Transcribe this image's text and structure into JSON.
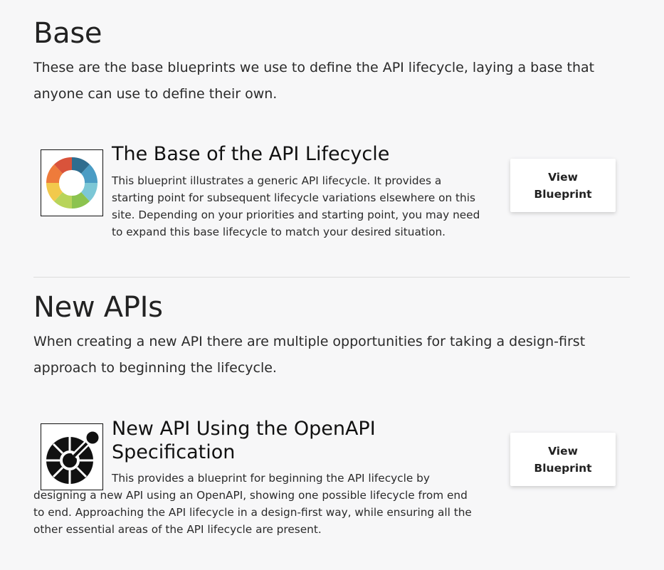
{
  "sections": [
    {
      "title": "Base",
      "description": "These are the base blueprints we use to define the API lifecycle, laying a base that anyone can use to define their own.",
      "card": {
        "title": "The Base of the API Lifecycle",
        "description": "This blueprint illustrates a generic API lifecycle. It provides a starting point for subsequent lifecycle variations elsewhere on this site. Depending on your priorities and starting point, you may need to expand this base lifecycle to match your desired situation.",
        "button_label": "View Blueprint",
        "image_icon": "lifecycle-cycle-diagram-icon"
      }
    },
    {
      "title": "New APIs",
      "description": "When creating a new API there are multiple opportunities for taking a design-first approach to beginning the lifecycle.",
      "card": {
        "title": "New API Using the OpenAPI Specification",
        "description": "This provides a blueprint for beginning the API lifecycle by designing a new API using an OpenAPI, showing one possible lifecycle from end to end. Approaching the API lifecycle in a design-first way, while ensuring all the other essential areas of the API lifecycle are present.",
        "button_label": "View Blueprint",
        "image_icon": "openapi-logo-icon"
      }
    }
  ],
  "colors": {
    "background": "#f7f7f8",
    "text": "#222222",
    "divider": "#dcdcdc",
    "button_bg": "#ffffff"
  }
}
